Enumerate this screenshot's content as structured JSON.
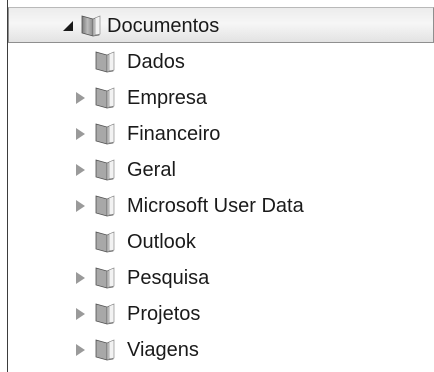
{
  "tree": {
    "root": {
      "label": "Documentos",
      "expanded": true,
      "icon": "folder-icon"
    },
    "children": [
      {
        "label": "Dados",
        "has_children": false,
        "icon": "folder-icon"
      },
      {
        "label": "Empresa",
        "has_children": true,
        "icon": "folder-icon"
      },
      {
        "label": "Financeiro",
        "has_children": true,
        "icon": "folder-icon"
      },
      {
        "label": "Geral",
        "has_children": true,
        "icon": "folder-icon"
      },
      {
        "label": "Microsoft User Data",
        "has_children": true,
        "icon": "folder-icon"
      },
      {
        "label": "Outlook",
        "has_children": false,
        "icon": "folder-icon"
      },
      {
        "label": "Pesquisa",
        "has_children": true,
        "icon": "folder-icon"
      },
      {
        "label": "Projetos",
        "has_children": true,
        "icon": "folder-icon"
      },
      {
        "label": "Viagens",
        "has_children": true,
        "icon": "folder-icon"
      }
    ]
  },
  "colors": {
    "selected_row_top": "#ececec",
    "selected_row_bottom": "#e3e3e3",
    "arrow_collapsed": "#9a9a9a",
    "arrow_expanded": "#1a1a1a",
    "text": "#1a1a1a"
  }
}
